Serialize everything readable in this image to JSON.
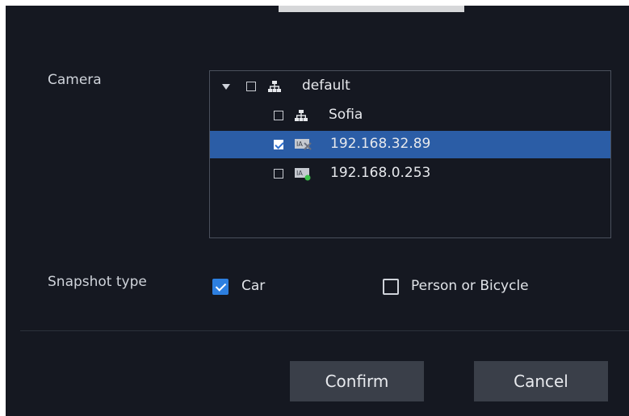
{
  "labels": {
    "camera": "Camera",
    "snapshot_type": "Snapshot type"
  },
  "tree": {
    "items": [
      {
        "label": "default",
        "icon": "network-icon",
        "expanded": true,
        "checked": false,
        "selected": false
      },
      {
        "label": "Sofia",
        "icon": "network-icon",
        "checked": false,
        "selected": false
      },
      {
        "label": "192.168.32.89",
        "icon": "camera-offline-icon",
        "checked": true,
        "selected": true
      },
      {
        "label": "192.168.0.253",
        "icon": "camera-online-icon",
        "checked": false,
        "selected": false
      }
    ]
  },
  "snapshot_options": [
    {
      "label": "Car",
      "checked": true
    },
    {
      "label": "Person or Bicycle",
      "checked": false
    }
  ],
  "buttons": {
    "confirm": "Confirm",
    "cancel": "Cancel"
  },
  "colors": {
    "background": "#151821",
    "selection": "#2b5da6",
    "accent": "#2d7fe0",
    "button": "#3a3f49"
  }
}
